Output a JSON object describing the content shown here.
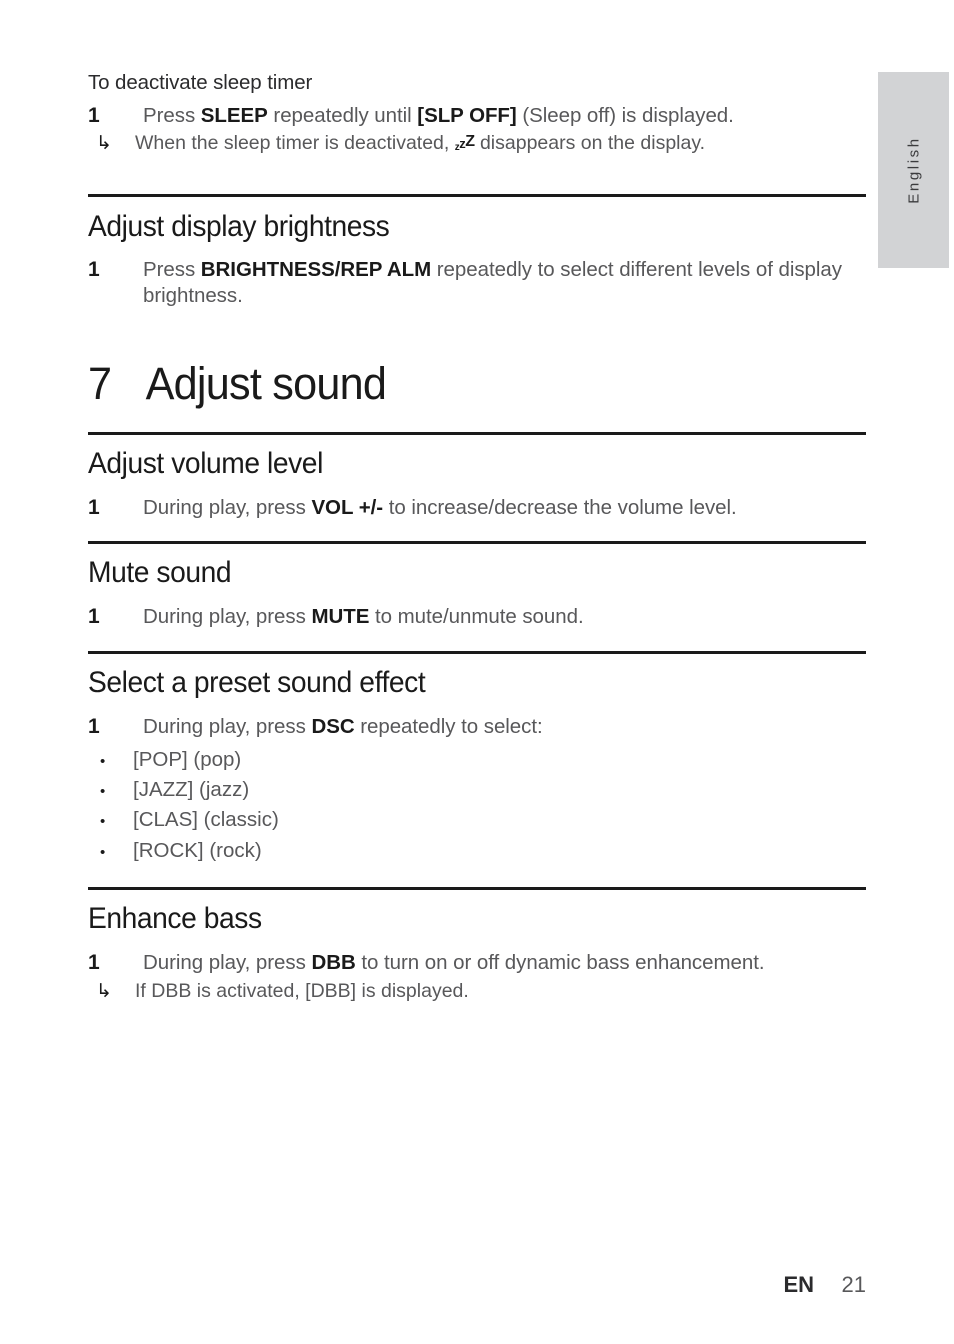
{
  "side_tab": {
    "language": "English"
  },
  "sections": {
    "sleep_deactivate": {
      "label": "To deactivate sleep timer",
      "step_num": "1",
      "step_prefix": "Press ",
      "step_key": "SLEEP",
      "step_mid": " repeatedly until ",
      "step_key2": "[SLP OFF]",
      "step_suffix": " (Sleep off) is displayed.",
      "note_arrow": "↳",
      "note_prefix": "When the sleep timer is deactivated, ",
      "note_glyph_1": "z",
      "note_glyph_2": "z",
      "note_glyph_3": "Z",
      "note_suffix": " disappears on the display."
    },
    "brightness": {
      "heading": "Adjust display brightness",
      "step_num": "1",
      "step_prefix": "Press ",
      "step_key": "BRIGHTNESS/REP ALM",
      "step_suffix": " repeatedly to select different levels of display brightness."
    },
    "chapter": {
      "number": "7",
      "title": "Adjust sound"
    },
    "volume": {
      "heading": "Adjust volume level",
      "step_num": "1",
      "step_prefix": "During play, press ",
      "step_key": "VOL +/-",
      "step_suffix": " to increase/decrease the volume level."
    },
    "mute": {
      "heading": "Mute sound",
      "step_num": "1",
      "step_prefix": "During play, press ",
      "step_key": "MUTE",
      "step_suffix": " to mute/unmute sound."
    },
    "preset": {
      "heading": "Select a preset sound effect",
      "step_num": "1",
      "step_prefix": "During play, press ",
      "step_key": "DSC",
      "step_suffix": " repeatedly to select:",
      "bullet_char": "•",
      "options": [
        "[POP] (pop)",
        "[JAZZ] (jazz)",
        "[CLAS] (classic)",
        "[ROCK] (rock)"
      ]
    },
    "bass": {
      "heading": "Enhance bass",
      "step_num": "1",
      "step_prefix": "During play, press ",
      "step_key": "DBB",
      "step_suffix": " to turn on or off dynamic bass enhancement.",
      "note_arrow": "↳",
      "note_text": "If DBB is activated, [DBB] is displayed."
    }
  },
  "footer": {
    "lang_code": "EN",
    "page_number": "21"
  }
}
